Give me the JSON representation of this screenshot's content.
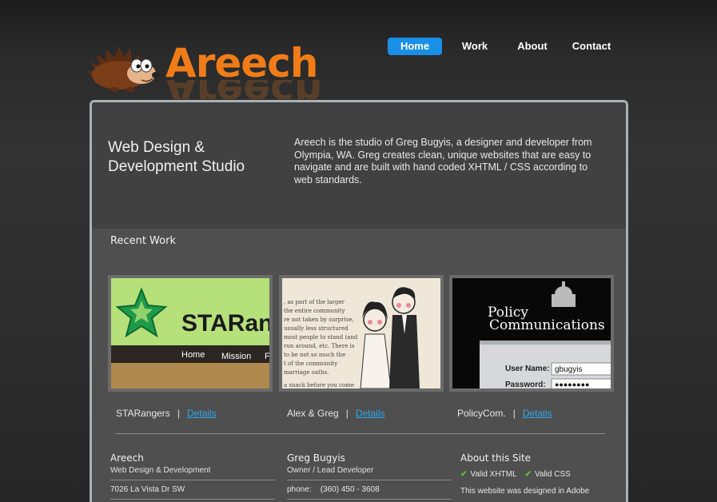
{
  "logo": {
    "text": "Areech"
  },
  "nav": {
    "home": "Home",
    "work": "Work",
    "about": "About",
    "contact": "Contact"
  },
  "intro": {
    "tagline_line1": "Web Design &",
    "tagline_line2": "Development Studio",
    "text": "Areech is the studio of Greg Bugyis, a designer and developer from Olympia, WA. Greg creates clean, unique websites that are easy to navigate and are built with hand coded XHTML / CSS according to web standards."
  },
  "recent_work": {
    "title": "Recent Work",
    "items": [
      {
        "name": "STARangers",
        "details": "Details",
        "thumb_text": "STARan",
        "thumb_nav": [
          "Home",
          "Mission",
          "F"
        ]
      },
      {
        "name": "Alex & Greg",
        "details": "Details",
        "thumb_lines": [
          ", as part of the larger",
          "the entire community",
          "re not taken by surprise,",
          "usually less structured",
          "most people to stand (and",
          "run around, etc. There is",
          "to be not so much the",
          "t of the community",
          "marriage oaths.",
          "",
          "a snack before you come"
        ]
      },
      {
        "name": "PolicyCom.",
        "details": "Details",
        "thumb_title_1": "Policy",
        "thumb_title_2": "Communications",
        "thumb_user_label": "User Name:",
        "thumb_user_value": "gbugyis",
        "thumb_pass_label": "Password:",
        "thumb_pass_value": "●●●●●●●●"
      }
    ],
    "separator": "|"
  },
  "footer": {
    "col1": {
      "head": "Areech",
      "sub": "Web Design & Development",
      "address": "7026 La Vista Dr SW"
    },
    "col2": {
      "head": "Greg Bugyis",
      "sub": "Owner / Lead Developer",
      "phone": "phone:    (360) 450 - 3608"
    },
    "col3": {
      "head": "About this Site",
      "valid1": "Valid XHTML",
      "valid2": "Valid CSS",
      "note": "This website was designed in Adobe"
    }
  },
  "colors": {
    "accent": "#1a8fe6",
    "logo": "#f07c18",
    "link": "#2fa5ea",
    "check": "#5bc236"
  }
}
